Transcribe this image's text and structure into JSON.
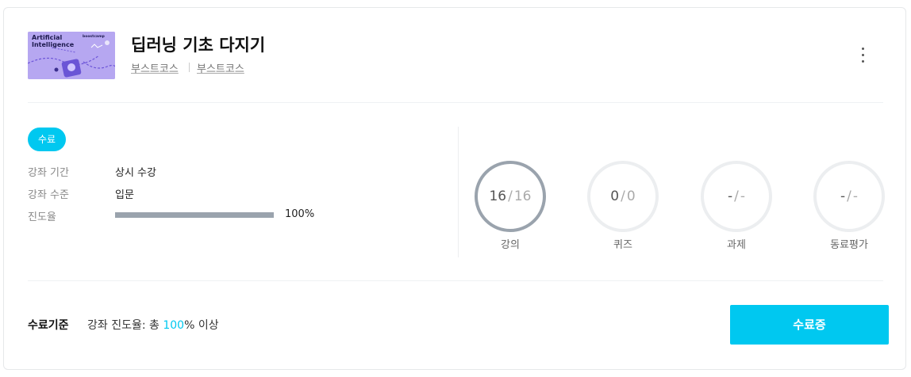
{
  "course": {
    "title": "딥러닝 기초 다지기",
    "provider_1": "부스트코스",
    "provider_2": "부스트코스",
    "thumbnail": {
      "text_line1": "Artificial",
      "text_line2": "Intelligence",
      "brand": "boostcamp"
    }
  },
  "status_badge": "수료",
  "info": [
    {
      "label": "강좌 기간",
      "value": "상시 수강"
    },
    {
      "label": "강좌 수준",
      "value": "입문"
    },
    {
      "label": "진도율",
      "value": "100%",
      "progress": 1.0
    }
  ],
  "stats": [
    {
      "label": "강의",
      "done": "16",
      "total": "16",
      "active": true
    },
    {
      "label": "퀴즈",
      "done": "0",
      "total": "0",
      "active": false
    },
    {
      "label": "과제",
      "done": "-",
      "total": "-",
      "active": false
    },
    {
      "label": "동료평가",
      "done": "-",
      "total": "-",
      "active": false
    }
  ],
  "criteria": {
    "title": "수료기준",
    "text_prefix": "강좌 진도율: 총 ",
    "highlight": "100",
    "text_suffix": "% 이상"
  },
  "complete_button": "수료증",
  "colors": {
    "accent": "#00c8f0",
    "ring_active": "#9aa3ad",
    "ring_inactive": "#eceef0",
    "progress_fill": "#9aa3ad"
  }
}
